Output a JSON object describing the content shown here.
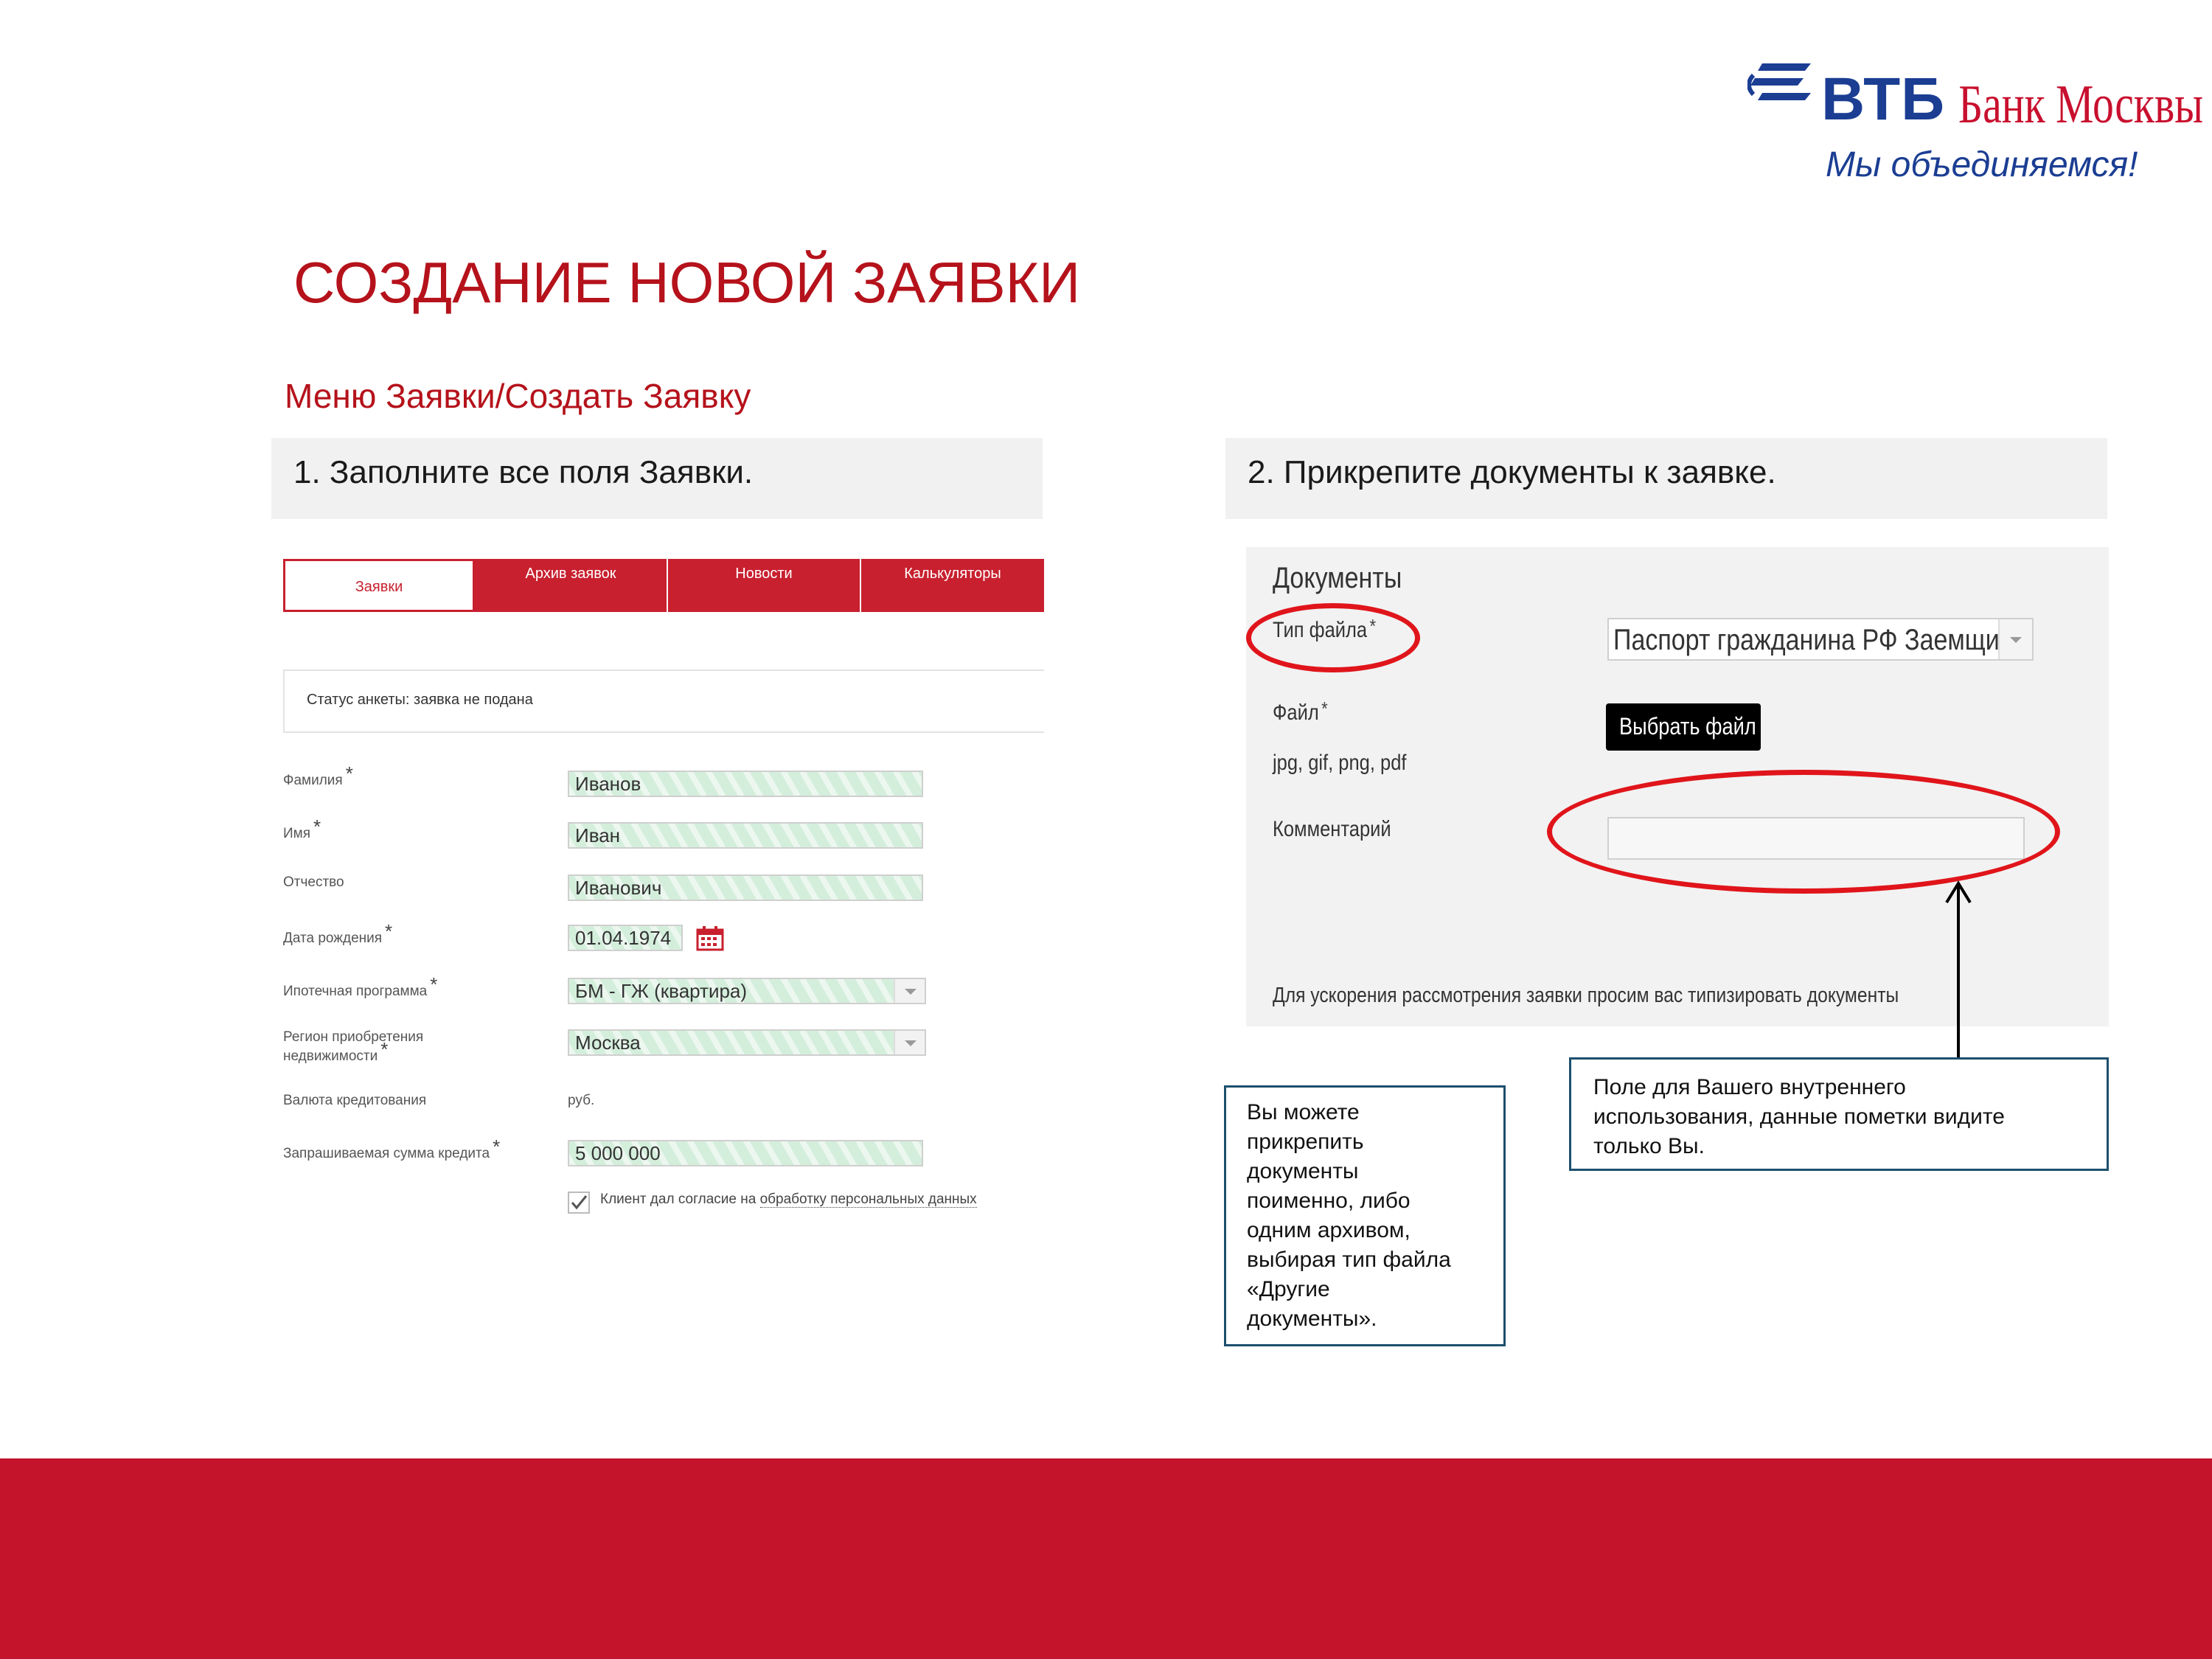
{
  "brand": {
    "name_vtb": "ВТБ",
    "name_bank": "Банк Москвы",
    "slogan": "Мы объединяемся!",
    "colors": {
      "red": "#c4142c",
      "blue": "#1b3e93"
    }
  },
  "page": {
    "title": "СОЗДАНИЕ НОВОЙ ЗАЯВКИ",
    "breadcrumb": "Меню Заявки/Создать Заявку",
    "step1": "1. Заполните все поля Заявки.",
    "step2": "2. Прикрепите документы к заявке."
  },
  "tabs": [
    {
      "label": "Заявки",
      "active": true
    },
    {
      "label": "Архив заявок",
      "active": false
    },
    {
      "label": "Новости",
      "active": false
    },
    {
      "label": "Калькуляторы",
      "active": false
    }
  ],
  "status": "Статус анкеты: заявка не подана",
  "form": {
    "lastname_label": "Фамилия",
    "lastname_value": "Иванов",
    "firstname_label": "Имя",
    "firstname_value": "Иван",
    "patronymic_label": "Отчество",
    "patronymic_value": "Иванович",
    "birthdate_label": "Дата рождения",
    "birthdate_value": "01.04.1974",
    "program_label": "Ипотечная программа",
    "program_value": "БМ - ГЖ (квартира)",
    "region_label_line1": "Регион приобретения",
    "region_label_line2": "недвижимости",
    "region_value": "Москва",
    "currency_label": "Валюта кредитования",
    "currency_value": "руб.",
    "amount_label": "Запрашиваемая сумма кредита",
    "amount_value": "5 000 000",
    "consent_text": "Клиент дал согласие на",
    "consent_link": "обработку персональных данных",
    "consent_checked": true,
    "required_mark": "*"
  },
  "documents": {
    "heading": "Документы",
    "filetype_label": "Тип файла",
    "filetype_value": "Паспорт гражданина РФ Заемщик",
    "file_label": "Файл",
    "choose_file_button": "Выбрать файл",
    "allowed_formats": "jpg, gif, png, pdf",
    "comment_label": "Комментарий",
    "comment_value": "",
    "hint": "Для ускорения рассмотрения заявки просим вас типизировать документы",
    "highlight_color": "#e0151b"
  },
  "notes": {
    "comment_note": [
      "Поле для Вашего внутреннего",
      "использования, данные пометки видите",
      "только Вы."
    ],
    "attach_note": [
      "Вы можете",
      "прикрепить",
      "документы",
      "поименно, либо",
      "одним архивом,",
      "выбирая тип файла",
      "«Другие",
      "документы»."
    ]
  }
}
